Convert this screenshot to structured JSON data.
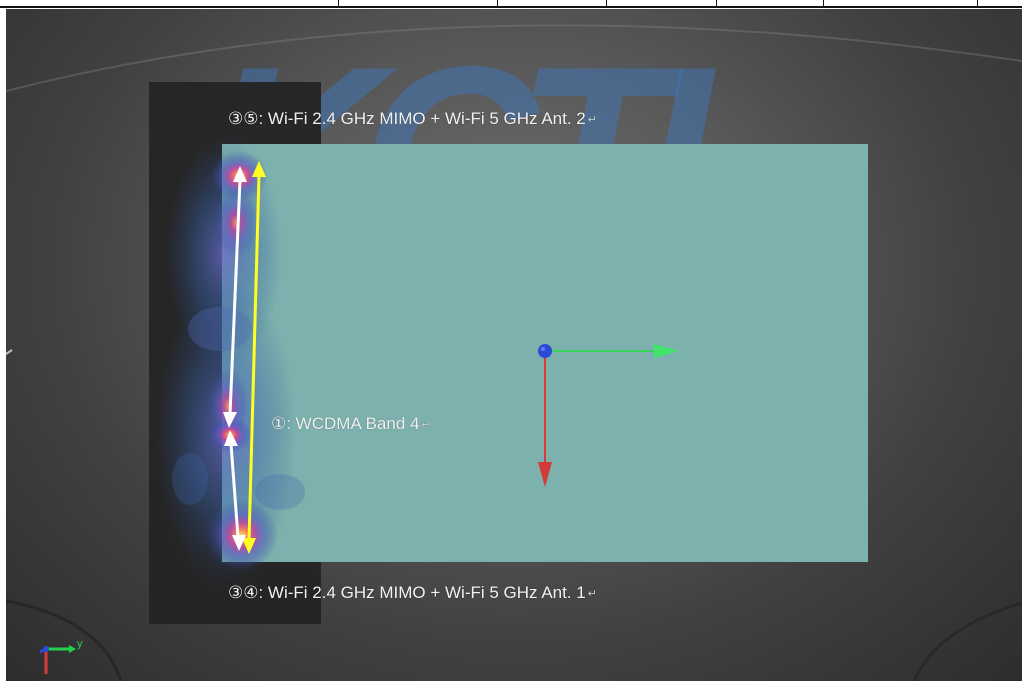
{
  "labels": {
    "top": "③⑤: Wi-Fi 2.4 GHz MIMO + Wi-Fi 5 GHz Ant. 2",
    "middle": "①: WCDMA Band 4",
    "bottom": "③④: Wi-Fi 2.4 GHz MIMO + Wi-Fi 5 GHz Ant. 1",
    "return_mark": "↵"
  },
  "watermark": {
    "text": "KCTL"
  },
  "axis_widget": {
    "y_label": "y"
  },
  "colors": {
    "background_dark": "#2d2d2d",
    "background_light": "#6f6f6f",
    "panel_dark": "#242424",
    "panel_teal": "#7cb1ae",
    "watermark_blue": "#3975b7",
    "arrow_white": "#ffffff",
    "arrow_yellow": "#ffff22",
    "axis_green": "#38d15b",
    "axis_red": "#d83a3a",
    "axis_blue": "#2a48d8"
  },
  "icons": {
    "antenna_span_arrows": "double-headed-arrow",
    "origin_marker": "sphere-origin-icon",
    "coordinate_axes": "axis-triad-icon"
  }
}
